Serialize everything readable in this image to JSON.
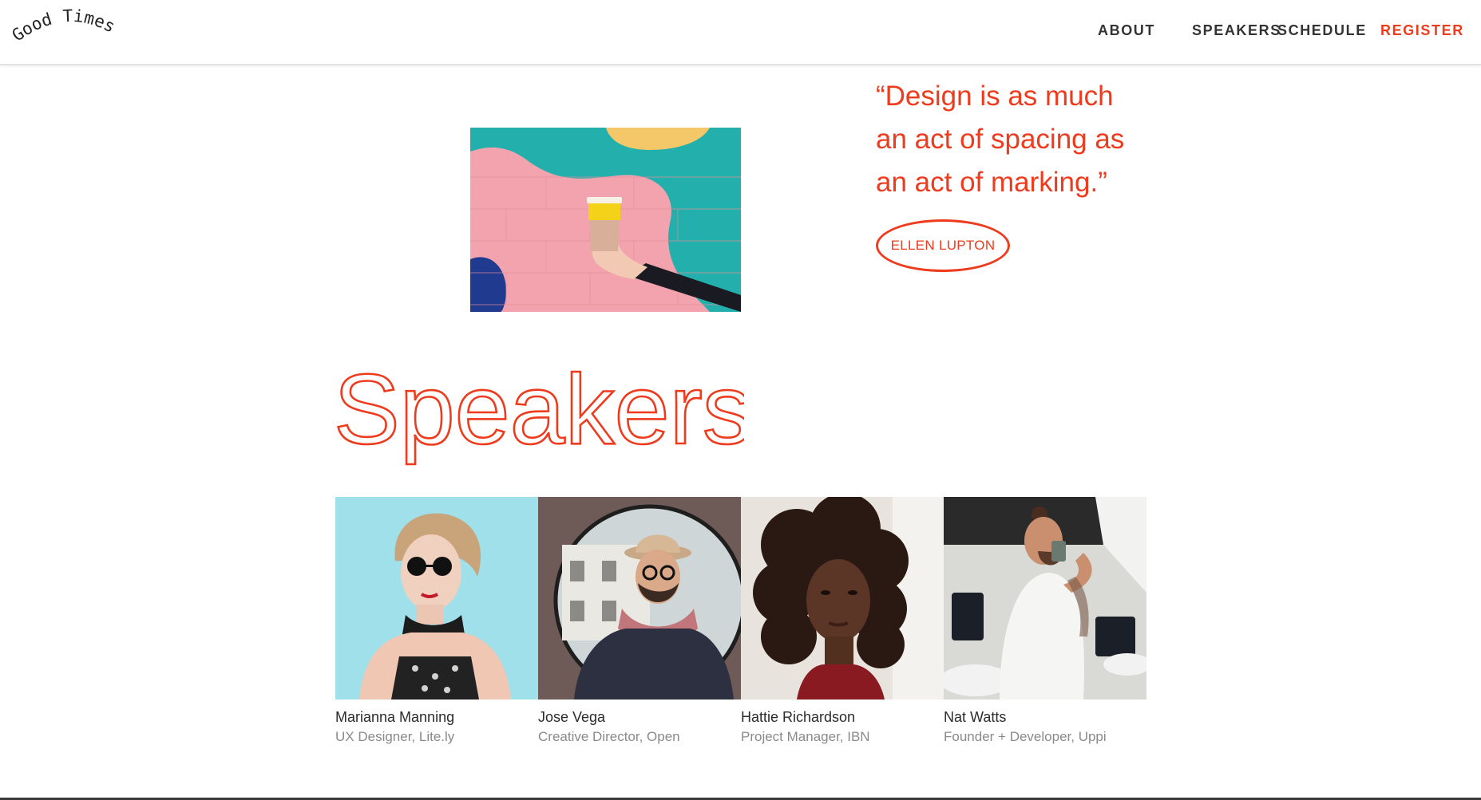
{
  "brand": {
    "logo_text": "Good Times",
    "accent": "#ee3b1d"
  },
  "nav": {
    "items": [
      {
        "label": "ABOUT"
      },
      {
        "label": "SPEAKERS"
      },
      {
        "label": "SCHEDULE"
      },
      {
        "label": "REGISTER",
        "highlight": true
      }
    ]
  },
  "quote": {
    "lines": [
      "“Design is as much",
      "an act of spacing as",
      "an act of marking.”"
    ],
    "author": "ELLEN LUPTON"
  },
  "speakers": {
    "heading": "Speakers",
    "items": [
      {
        "name": "Marianna Manning",
        "role": "UX Designer, Lite.ly"
      },
      {
        "name": "Jose Vega",
        "role": "Creative Director, Open"
      },
      {
        "name": "Hattie Richardson",
        "role": "Project Manager, IBN"
      },
      {
        "name": "Nat Watts",
        "role": "Founder + Developer, Uppi"
      }
    ]
  }
}
